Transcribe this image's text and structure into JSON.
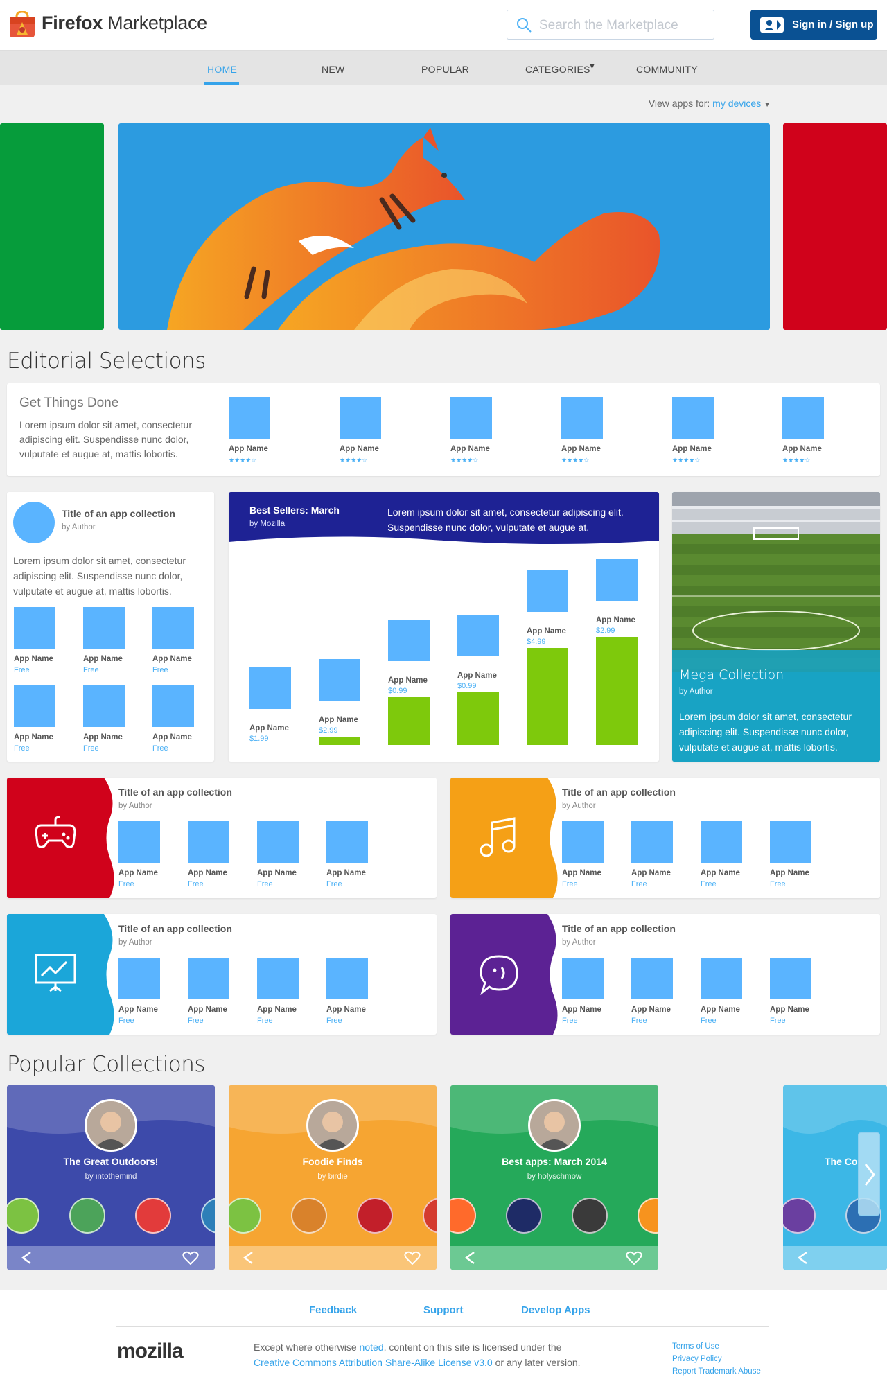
{
  "header": {
    "brand_bold": "Firefox",
    "brand_rest": " Marketplace",
    "search_placeholder": "Search the Marketplace",
    "signin_label": "Sign in / Sign up"
  },
  "nav": {
    "items": [
      "HOME",
      "NEW",
      "POPULAR",
      "CATEGORIES",
      "COMMUNITY"
    ],
    "active": "HOME"
  },
  "viewfor": {
    "label": "View apps for: ",
    "link": "my devices"
  },
  "editorial": {
    "heading": "Editorial Selections",
    "featured": {
      "title": "Get Things Done",
      "text": "Lorem ipsum dolor sit amet, consectetur adipiscing elit. Suspendisse nunc dolor, vulputate et augue at, mattis lobortis.",
      "apps": [
        {
          "name": "App Name",
          "stars": "★★★★☆"
        },
        {
          "name": "App Name",
          "stars": "★★★★☆"
        },
        {
          "name": "App Name",
          "stars": "★★★★☆"
        },
        {
          "name": "App Name",
          "stars": "★★★★☆"
        },
        {
          "name": "App Name",
          "stars": "★★★★☆"
        },
        {
          "name": "App Name",
          "stars": "★★★★☆"
        }
      ]
    },
    "collection": {
      "title": "Title of an app collection",
      "author": "by Author",
      "text": "Lorem ipsum dolor sit amet, consectetur adipiscing elit. Suspendisse nunc dolor, vulputate et augue at, mattis lobortis.",
      "apps": [
        {
          "name": "App Name",
          "price": "Free"
        },
        {
          "name": "App Name",
          "price": "Free"
        },
        {
          "name": "App Name",
          "price": "Free"
        },
        {
          "name": "App Name",
          "price": "Free"
        },
        {
          "name": "App Name",
          "price": "Free"
        },
        {
          "name": "App Name",
          "price": "Free"
        }
      ]
    },
    "bestsellers": {
      "title": "Best Sellers: March",
      "by": "by Mozilla",
      "text": "Lorem ipsum dolor sit amet, consectetur adipiscing elit. Suspendisse nunc dolor, vulputate et augue at.",
      "apps": [
        {
          "name": "App Name",
          "price": "$1.99",
          "bar": 0
        },
        {
          "name": "App Name",
          "price": "$2.99",
          "bar": 0.08
        },
        {
          "name": "App Name",
          "price": "$0.99",
          "bar": 0.44
        },
        {
          "name": "App Name",
          "price": "$0.99",
          "bar": 0.49
        },
        {
          "name": "App Name",
          "price": "$4.99",
          "bar": 0.9
        },
        {
          "name": "App Name",
          "price": "$2.99",
          "bar": 1.0
        }
      ]
    },
    "mega": {
      "title": "Mega Collection",
      "author": "by Author",
      "text": "Lorem ipsum dolor sit amet, consectetur adipiscing elit. Suspendisse nunc dolor, vulputate et augue at, mattis lobortis."
    },
    "colored": [
      {
        "color": "#d0021b",
        "icon": "gamepad-icon",
        "title": "Title of an app collection",
        "author": "by Author"
      },
      {
        "color": "#f5a016",
        "icon": "music-note-icon",
        "title": "Title of an app collection",
        "author": "by Author"
      },
      {
        "color": "#1ba6d9",
        "icon": "presentation-icon",
        "title": "Title of an app collection",
        "author": "by Author"
      },
      {
        "color": "#5c2294",
        "icon": "chat-bubble-icon",
        "title": "Title of an app collection",
        "author": "by Author"
      }
    ],
    "colored_app": {
      "name": "App Name",
      "price": "Free"
    }
  },
  "popular": {
    "heading": "Popular Collections",
    "items": [
      {
        "title": "The Great Outdoors!",
        "by": "by intothemind",
        "color": "#3d4aaa",
        "bot": "#7a85c8"
      },
      {
        "title": "Foodie Finds",
        "by": "by birdie",
        "color": "#f6a532",
        "bot": "#fac578"
      },
      {
        "title": "Best apps: March 2014",
        "by": "by holyschmow",
        "color": "#25a95a",
        "bot": "#6cc993"
      },
      {
        "title": "The Co",
        "by": "",
        "color": "#3cb7e6",
        "bot": "#7fd0ef"
      }
    ]
  },
  "footer": {
    "links": [
      "Feedback",
      "Support",
      "Develop Apps"
    ],
    "logo": "mozilla",
    "lic1": "Except where otherwise ",
    "lic_link": "noted",
    "lic2": ", content on this site is licensed under the",
    "lic_link2": "Creative Commons Attribution Share-Alike License v3.0",
    "lic3": " or any later version.",
    "small": [
      "Terms of Use",
      "Privacy Policy",
      "Report Trademark Abuse"
    ]
  }
}
